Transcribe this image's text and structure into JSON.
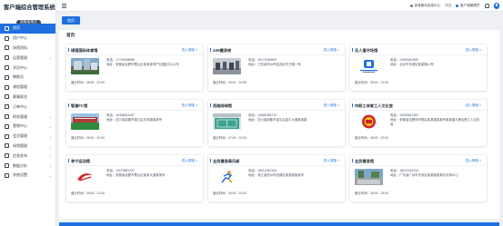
{
  "app": {
    "title": "客户端综合管理系统",
    "badge": "超级管理员"
  },
  "sidebar": {
    "items": [
      {
        "label": "首页",
        "active": true,
        "expandable": false
      },
      {
        "label": "用户中心",
        "active": false,
        "expandable": false
      },
      {
        "label": "场馆资料",
        "active": false,
        "expandable": false
      },
      {
        "label": "运营管理",
        "active": false,
        "expandable": true
      },
      {
        "label": "学员中心",
        "active": false,
        "expandable": false
      },
      {
        "label": "教练员",
        "active": false,
        "expandable": false
      },
      {
        "label": "课程管理",
        "active": false,
        "expandable": false
      },
      {
        "label": "赛事报名",
        "active": false,
        "expandable": false
      },
      {
        "label": "订单中心",
        "active": false,
        "expandable": false
      },
      {
        "label": "财务管理",
        "active": false,
        "expandable": true
      },
      {
        "label": "营销中心",
        "active": false,
        "expandable": true
      },
      {
        "label": "会员管理",
        "active": false,
        "expandable": true
      },
      {
        "label": "场馆管理",
        "active": false,
        "expandable": true
      },
      {
        "label": "信息发布",
        "active": false,
        "expandable": true
      },
      {
        "label": "数据分析",
        "active": false,
        "expandable": true
      },
      {
        "label": "系统设置",
        "active": false,
        "expandable": true
      }
    ]
  },
  "topbar": {
    "notice": "体育服务信息中心",
    "language": "中文",
    "user": "客户端管理员"
  },
  "tab": {
    "label": "首页"
  },
  "page": {
    "title": "首页"
  },
  "labels": {
    "phone": "电话：",
    "address": "地址：",
    "hours": "营业时间：",
    "detail": "进入场馆 >"
  },
  "venues": [
    {
      "name": "绿茵国际体育馆",
      "phone": "17700008888",
      "address": "安徽省合肥市蜀山区某某体育产业园区中心1号",
      "hours": "08:00 - 22:00",
      "thumb": "sports-building"
    },
    {
      "name": "24H健身房",
      "phone": "15170240609",
      "address": "江苏省苏州市姑苏区东方路一号",
      "hours": "00:00 - 23:59",
      "thumb": "gym-interior"
    },
    {
      "name": "无人值守场馆",
      "phone": "13900481959",
      "address": "北京市东城区某某路12号",
      "hours": "09:00 - 21:00",
      "thumb": "logo-building"
    },
    {
      "name": "智慧FC馆",
      "phone": "15358181187",
      "address": "四川省成都市锦江区东风路某某号",
      "hours": "08:00 - 22:00",
      "thumb": "football-field"
    },
    {
      "name": "西路网球馆",
      "phone": "13886786710",
      "address": "四川省成都市金牛区金牛大道某某路",
      "hours": "07:00 - 22:00",
      "thumb": "tennis-court"
    },
    {
      "name": "市职工体育工人文化宫",
      "phone": "15309811263",
      "address": "安徽省合肥市庐阳区某某路某某号某某楼大厦合肥工人文化宫",
      "hours": "08:00 - 22:00",
      "thumb": "union-logo"
    },
    {
      "name": "李宁运动馆",
      "phone": "13179857227",
      "address": "安徽省合肥市蜀山区某某大道某某号",
      "hours": "09:00 - 21:00",
      "thumb": "lining-logo"
    },
    {
      "name": "全民健身俱乐部",
      "phone": "18012342345",
      "address": "浙江省杭州市西湖区某某路某某号",
      "hours": "06:00 - 22:00",
      "thumb": "runner-logo"
    },
    {
      "name": "全民健身馆",
      "phone": "18012341234",
      "address": "广东省广州市天河区某某路某某号文体中心",
      "hours": "08:00 - 23:00",
      "thumb": "outdoor-court"
    }
  ]
}
